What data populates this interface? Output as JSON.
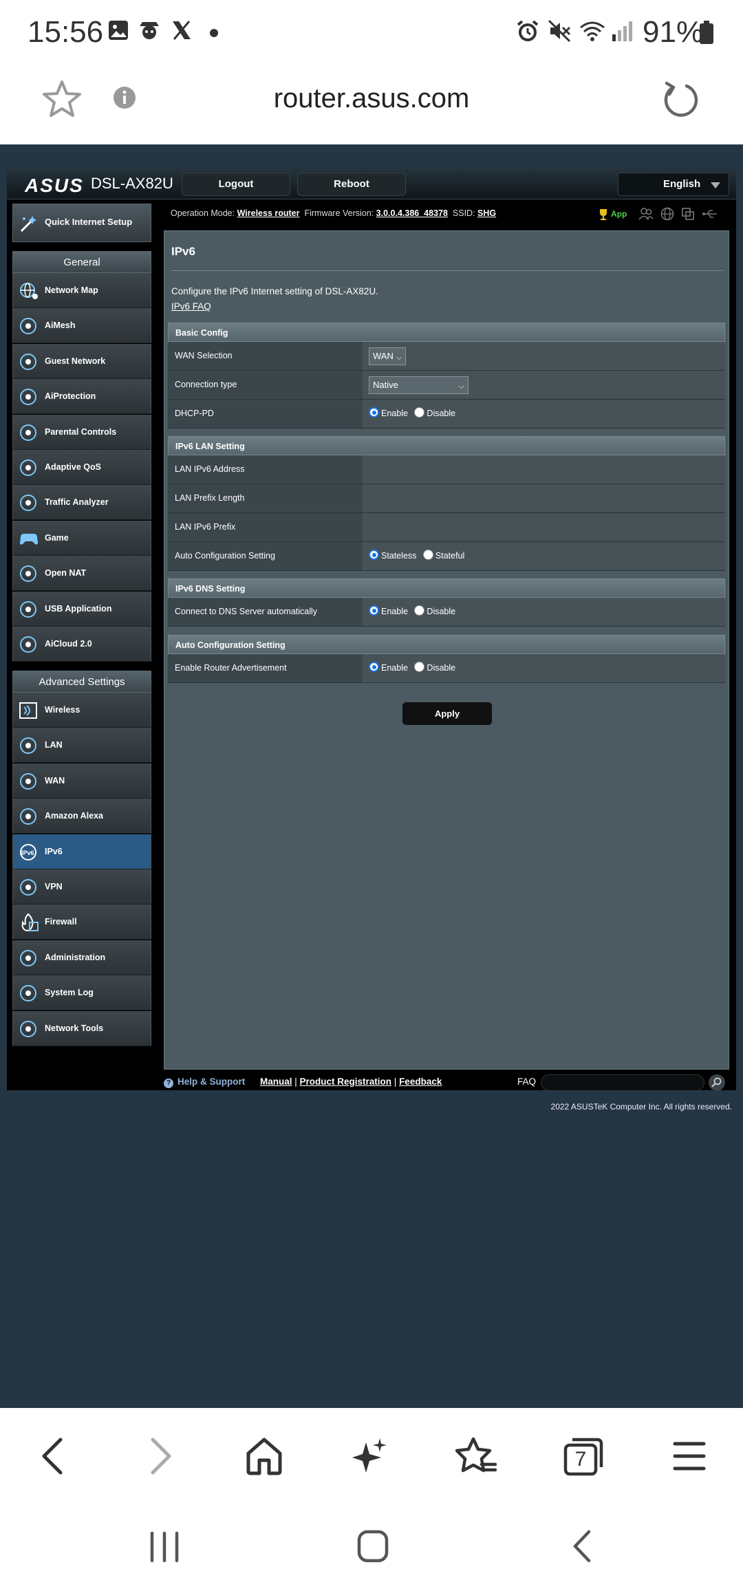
{
  "status_bar": {
    "time": "15:56",
    "battery": "91%"
  },
  "browser": {
    "url": "router.asus.com",
    "tab_count": "7"
  },
  "header": {
    "logo": "ASUS",
    "model": "DSL-AX82U",
    "logout": "Logout",
    "reboot": "Reboot",
    "language": "English",
    "operation_mode_label": "Operation Mode:",
    "operation_mode": "Wireless router",
    "firmware_label": "Firmware Version:",
    "firmware": "3.0.0.4.386_48378",
    "ssid_label": "SSID:",
    "ssid": "SHG",
    "app_label": "App"
  },
  "sidebar": {
    "quick_setup": "Quick Internet Setup",
    "general_heading": "General",
    "general": [
      {
        "label": "Network Map",
        "icon": "network-map-icon"
      },
      {
        "label": "AiMesh",
        "icon": "aimesh-icon"
      },
      {
        "label": "Guest Network",
        "icon": "guest-network-icon"
      },
      {
        "label": "AiProtection",
        "icon": "aiprotection-icon"
      },
      {
        "label": "Parental Controls",
        "icon": "parental-controls-icon"
      },
      {
        "label": "Adaptive QoS",
        "icon": "adaptive-qos-icon"
      },
      {
        "label": "Traffic Analyzer",
        "icon": "traffic-analyzer-icon"
      },
      {
        "label": "Game",
        "icon": "game-icon"
      },
      {
        "label": "Open NAT",
        "icon": "open-nat-icon"
      },
      {
        "label": "USB Application",
        "icon": "usb-application-icon"
      },
      {
        "label": "AiCloud 2.0",
        "icon": "aicloud-icon"
      }
    ],
    "advanced_heading": "Advanced Settings",
    "advanced": [
      {
        "label": "Wireless",
        "icon": "wireless-icon"
      },
      {
        "label": "LAN",
        "icon": "lan-icon"
      },
      {
        "label": "WAN",
        "icon": "wan-icon"
      },
      {
        "label": "Amazon Alexa",
        "icon": "alexa-icon"
      },
      {
        "label": "IPv6",
        "icon": "ipv6-icon"
      },
      {
        "label": "VPN",
        "icon": "vpn-icon"
      },
      {
        "label": "Firewall",
        "icon": "firewall-icon"
      },
      {
        "label": "Administration",
        "icon": "administration-icon"
      },
      {
        "label": "System Log",
        "icon": "system-log-icon"
      },
      {
        "label": "Network Tools",
        "icon": "network-tools-icon"
      }
    ]
  },
  "content": {
    "title": "IPv6",
    "description": "Configure the IPv6 Internet setting of DSL-AX82U.",
    "faq_link": "IPv6 FAQ",
    "basic_config": {
      "heading": "Basic Config",
      "wan_selection_label": "WAN Selection",
      "wan_selection_value": "WAN",
      "connection_type_label": "Connection type",
      "connection_type_value": "Native",
      "dhcp_pd_label": "DHCP-PD"
    },
    "lan_setting": {
      "heading": "IPv6 LAN Setting",
      "lan_ipv6_address": "LAN IPv6 Address",
      "lan_prefix_length": "LAN Prefix Length",
      "lan_ipv6_prefix": "LAN IPv6 Prefix",
      "auto_config": "Auto Configuration Setting",
      "stateless": "Stateless",
      "stateful": "Stateful"
    },
    "dns_setting": {
      "heading": "IPv6 DNS Setting",
      "connect_dns_auto": "Connect to DNS Server automatically"
    },
    "auto_config_setting": {
      "heading": "Auto Configuration Setting",
      "enable_router_adv": "Enable Router Advertisement"
    },
    "enable": "Enable",
    "disable": "Disable",
    "apply": "Apply"
  },
  "footer": {
    "help": "Help & Support",
    "manual": "Manual",
    "product_registration": "Product Registration",
    "feedback": "Feedback",
    "faq": "FAQ",
    "copyright": "2022 ASUSTeK Computer Inc. All rights reserved."
  }
}
